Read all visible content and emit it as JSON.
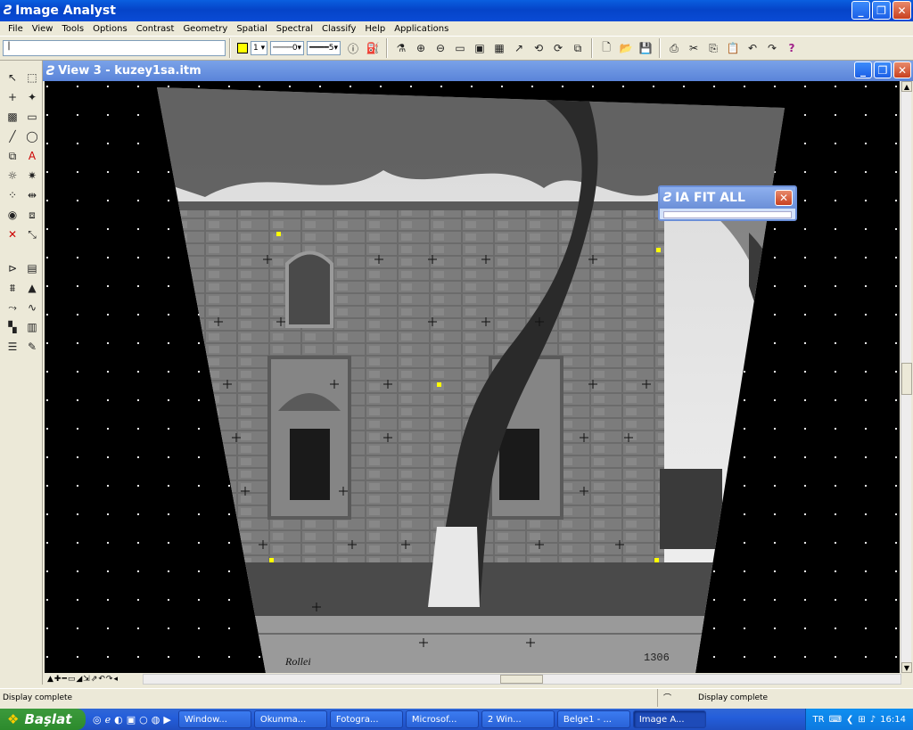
{
  "app": {
    "title": "Image Analyst",
    "icon": "image-analyst-icon"
  },
  "menu": [
    "File",
    "View",
    "Tools",
    "Options",
    "Contrast",
    "Geometry",
    "Spatial",
    "Spectral",
    "Classify",
    "Help",
    "Applications"
  ],
  "toolbar": {
    "coord_value": "|",
    "highlight_color": "#ffff00",
    "line_style_value": "1",
    "line_weight_value": "0",
    "line_size_value": "5"
  },
  "view": {
    "title": "View 3 - kuzey1sa.itm",
    "photo_text_brand": "Rollei",
    "photo_text_number": "1306"
  },
  "fit_popup": {
    "title": "IA FIT ALL"
  },
  "status": {
    "left": "Display complete",
    "right": "Display complete"
  },
  "taskbar": {
    "start": "Başlat",
    "tasks": [
      "Window...",
      "Okunma...",
      "Fotogra...",
      "Microsof...",
      "2 Win...",
      "Belge1 - ...",
      "Image A..."
    ],
    "lang": "TR",
    "clock": "16:14"
  },
  "colors": {
    "titlebar": "#0a5fe0",
    "taskbar": "#245edb",
    "start": "#3c9a3c",
    "grid_marker": "#ffff00"
  }
}
